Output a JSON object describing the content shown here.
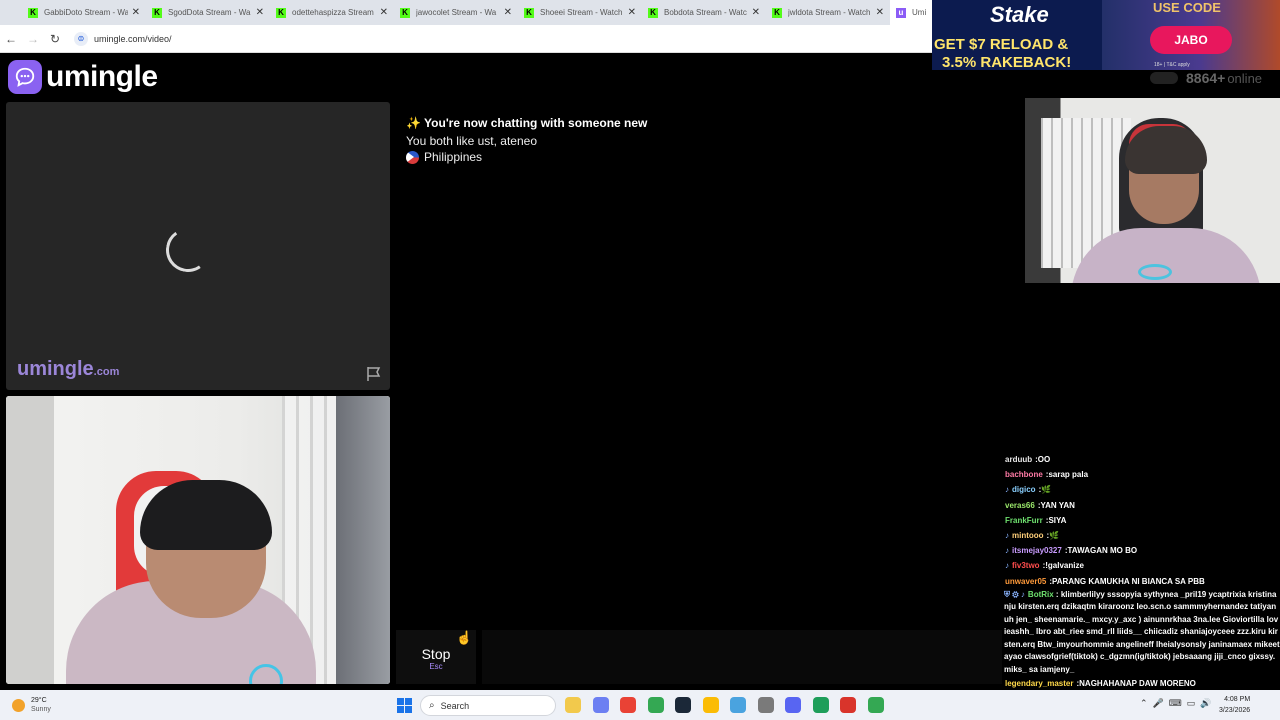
{
  "browser": {
    "tabs": [
      {
        "label": "GabbiDoto Stream - Wa",
        "icon": "kick-icon"
      },
      {
        "label": "SgodDota Stream - Wa",
        "icon": "kick-icon"
      },
      {
        "label": "odettehaspizza Stream",
        "icon": "kick-icon"
      },
      {
        "label": "jawocolet Stream - Wa",
        "icon": "kick-icon"
      },
      {
        "label": "Shoeei Stream - Watch",
        "icon": "kick-icon"
      },
      {
        "label": "Bobdota Stream - Watc",
        "icon": "kick-icon"
      },
      {
        "label": "jwldota Stream - Watch",
        "icon": "kick-icon"
      },
      {
        "label": "Umi",
        "icon": "umingle-icon"
      }
    ],
    "url": "umingle.com/video/"
  },
  "app": {
    "logo_text": "umingle",
    "brand_color": "#8a62f1",
    "watermark_main": "umingle",
    "watermark_tld": ".com",
    "chat": {
      "notice": "✨ You're now chatting with someone new",
      "interests": "You both like ust, ateneo",
      "country": "Philippines"
    },
    "stop_label": "Stop",
    "stop_key": "Esc"
  },
  "overlay": {
    "ad": {
      "brand": "Stake",
      "line1": "GET $7 RELOAD &",
      "line2": "3.5% RAKEBACK!",
      "use_code": "USE CODE",
      "code": "JABO",
      "fine": "18+ | T&C apply"
    },
    "online_count": "8864+",
    "online_label": "online"
  },
  "stream_chat": [
    {
      "user": "arduub",
      "color": "#e7e7e7",
      "msg": "OO"
    },
    {
      "user": "bachbone",
      "color": "#ff7aa5",
      "msg": "sarap pala"
    },
    {
      "user": "digico",
      "color": "#8ad0ff",
      "msg": "🌿",
      "badge": "♪"
    },
    {
      "user": "veras66",
      "color": "#9be86b",
      "msg": "YAN YAN"
    },
    {
      "user": "FrankFurr",
      "color": "#6ee06e",
      "msg": "SIYA"
    },
    {
      "user": "mintooo",
      "color": "#ffcf7a",
      "msg": "🌿",
      "badge": "♪"
    },
    {
      "user": "itsmejay0327",
      "color": "#c99cff",
      "msg": "TAWAGAN MO BO",
      "badge": "♪"
    },
    {
      "user": "fiv3two",
      "color": "#ff4d4d",
      "msg": "!galvanize",
      "badge": "♪"
    },
    {
      "user": "unwaver05",
      "color": "#ff9a3a",
      "msg": "PARANG KAMUKHA NI BIANCA SA PBB"
    }
  ],
  "botrix_message": {
    "user": "BotRix",
    "color": "#6ee06e",
    "badges": "⛨ ⚙ ♪",
    "msg": "klimberlilyy sssopyia sythynea _pril19 ycaptrixia kristinanju kirsten.erq dzikaqtm kiraroonz leo.scn.o sammmyhernandez tatiyanuh jen_ sheenamarie._ mxcy.y_axc ) ainunnrkhaa 3na.lee Gioviortilla lovieashh_ lbro abt_riee smd_rll liids__ chiicadiz shaniajoyceee zzz.kiru kirsten.erq Btw_imyourhommie angelineff lheialysonsly janinamaex mikeetayao clawsofgrief(tiktok) c_dgzmn(ig/tiktok) jebsaaang jiji_cnco gixssy.miks_ sa iamjeny_"
  },
  "last_message": {
    "user": "legendary_master",
    "color": "#ffd94a",
    "msg": "NAGHAHANAP DAW MORENO"
  },
  "taskbar": {
    "temp": "29°C",
    "condition": "Sunny",
    "search_placeholder": "Search",
    "time": "4:08 PM",
    "date": "3/23/2026",
    "apps": [
      {
        "name": "file-explorer-icon",
        "color": "#f2c94c"
      },
      {
        "name": "copilot-icon",
        "color": "#6c7ff2"
      },
      {
        "name": "chrome-icon",
        "color": "#e94235"
      },
      {
        "name": "chrome-icon",
        "color": "#34a853"
      },
      {
        "name": "steam-icon",
        "color": "#1b2838"
      },
      {
        "name": "chrome-icon",
        "color": "#fbbc05"
      },
      {
        "name": "notepad-icon",
        "color": "#4aa3df"
      },
      {
        "name": "tool-icon",
        "color": "#7a7a7a"
      },
      {
        "name": "discord-icon",
        "color": "#5865f2"
      },
      {
        "name": "app-icon",
        "color": "#1e9e5a"
      },
      {
        "name": "app-icon",
        "color": "#d9342b"
      },
      {
        "name": "chrome-icon",
        "color": "#34a853"
      }
    ]
  }
}
